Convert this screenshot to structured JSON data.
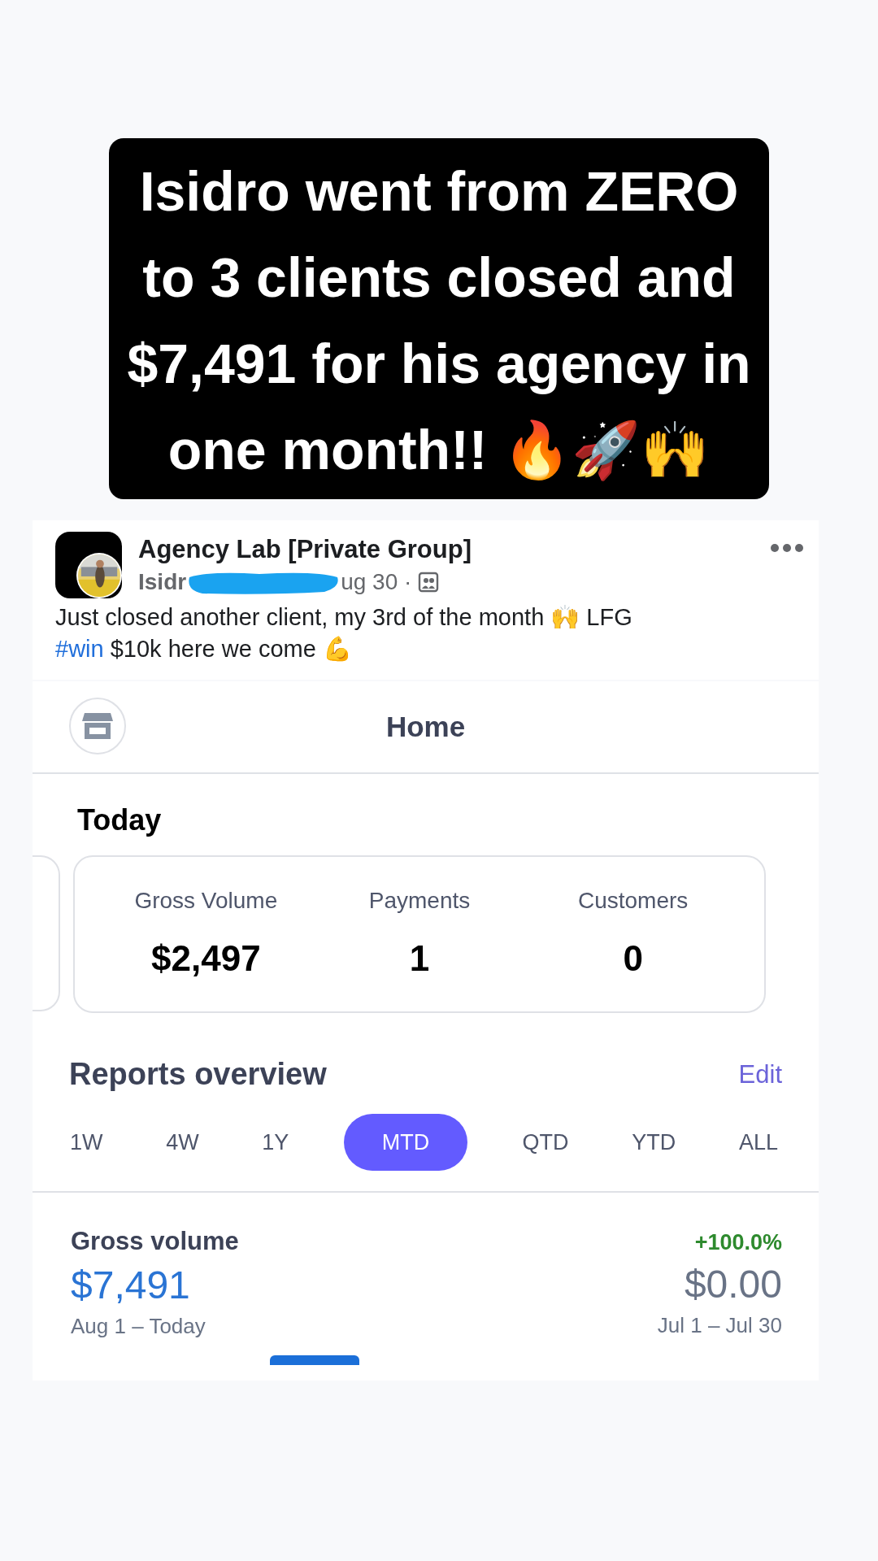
{
  "headline": "Isidro went from ZERO\nto 3 clients closed and\n$7,491 for his agency in\none month!! 🔥🚀🙌",
  "post": {
    "group": "Agency Lab [Private Group]",
    "author": "Isidr",
    "date": "ug 30 ·",
    "text_before": "Just closed another client, my 3rd of the month 🙌 LFG",
    "hashtag": "#win",
    "text_after": " $10k here we come 💪"
  },
  "app": {
    "title": "Home",
    "today": {
      "heading": "Today",
      "metrics": [
        {
          "label": "Gross Volume",
          "value": "$2,497"
        },
        {
          "label": "Payments",
          "value": "1"
        },
        {
          "label": "Customers",
          "value": "0"
        }
      ]
    },
    "reports": {
      "heading": "Reports overview",
      "edit": "Edit",
      "tabs": [
        {
          "label": "1W",
          "selected": false
        },
        {
          "label": "4W",
          "selected": false
        },
        {
          "label": "1Y",
          "selected": false
        },
        {
          "label": "MTD",
          "selected": true
        },
        {
          "label": "QTD",
          "selected": false
        },
        {
          "label": "YTD",
          "selected": false
        },
        {
          "label": "ALL",
          "selected": false
        }
      ],
      "gross": {
        "label": "Gross volume",
        "value": "$7,491",
        "range": "Aug 1 – Today",
        "change": "+100.0%",
        "previous": "$0.00",
        "previous_range": "Jul 1 – Jul 30"
      }
    }
  }
}
